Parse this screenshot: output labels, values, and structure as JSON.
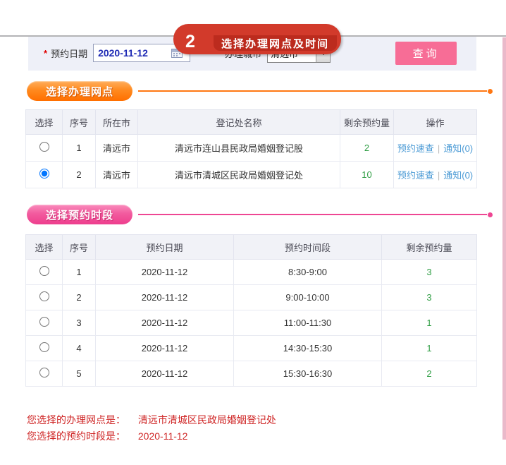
{
  "banner": {
    "step_number": "2",
    "title": "选择办理网点及时间"
  },
  "filter_bar": {
    "required_marker": "*",
    "date_label": "预约日期",
    "date_value": "2020-11-12",
    "city_label": "办理城市",
    "city_value": "清远市",
    "query_button": "查询"
  },
  "site_section": {
    "title": "选择办理网点",
    "table": {
      "headers": [
        "选择",
        "序号",
        "所在市",
        "登记处名称",
        "剩余预约量",
        "操作"
      ],
      "action_links": {
        "quick_check": "预约速查",
        "separator": "|",
        "notice": "通知(0)"
      },
      "rows": [
        {
          "no": "1",
          "city": "清远市",
          "name": "清远市连山县民政局婚姻登记股",
          "remaining": "2",
          "selected": false
        },
        {
          "no": "2",
          "city": "清远市",
          "name": "清远市清城区民政局婚姻登记处",
          "remaining": "10",
          "selected": true
        }
      ]
    }
  },
  "time_section": {
    "title": "选择预约时段",
    "table": {
      "headers": [
        "选择",
        "序号",
        "预约日期",
        "预约时间段",
        "剩余预约量"
      ],
      "rows": [
        {
          "no": "1",
          "date": "2020-11-12",
          "period": "8:30-9:00",
          "remaining": "3",
          "selected": false
        },
        {
          "no": "2",
          "date": "2020-11-12",
          "period": "9:00-10:00",
          "remaining": "3",
          "selected": false
        },
        {
          "no": "3",
          "date": "2020-11-12",
          "period": "11:00-11:30",
          "remaining": "1",
          "selected": false
        },
        {
          "no": "4",
          "date": "2020-11-12",
          "period": "14:30-15:30",
          "remaining": "1",
          "selected": false
        },
        {
          "no": "5",
          "date": "2020-11-12",
          "period": "15:30-16:30",
          "remaining": "2",
          "selected": false
        }
      ]
    }
  },
  "summary": {
    "site_label": "您选择的办理网点是：",
    "site_value": "清远市清城区民政局婚姻登记处",
    "time_label": "您选择的预约时段是：",
    "time_value": "2020-11-12"
  },
  "colors": {
    "banner_red": "#d23a2b",
    "banner_inner_red": "#bc2b1e",
    "accent_orange": "#ff7712",
    "accent_pink": "#ee4693",
    "button_pink": "#f76d96",
    "remaining_green": "#2f9e44",
    "link_blue": "#4a9ad5",
    "summary_red": "#cf2525",
    "filter_bar_bg": "#eef0f8",
    "date_text_blue": "#1f2bb5"
  }
}
